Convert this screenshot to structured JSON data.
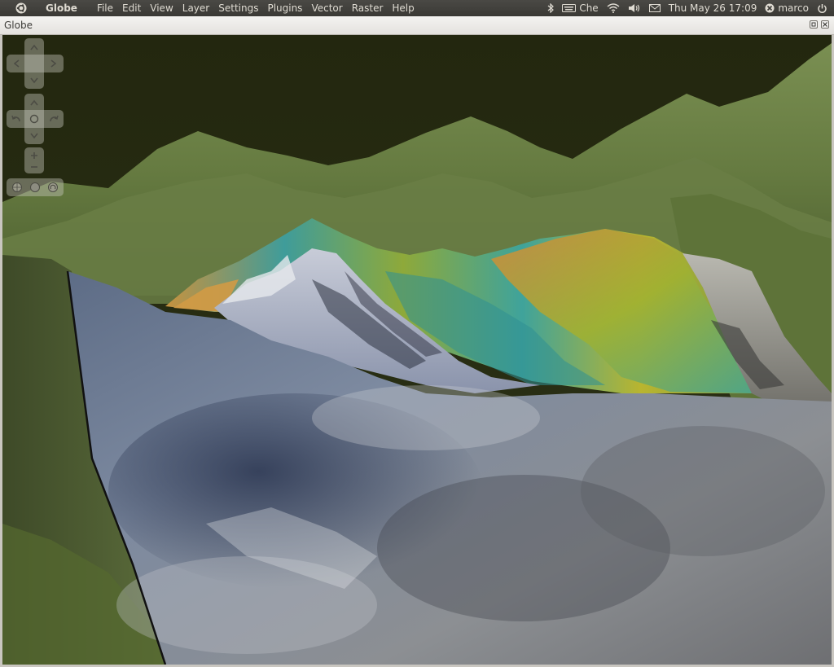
{
  "topbar": {
    "app_name": "Globe",
    "menu": [
      "File",
      "Edit",
      "View",
      "Layer",
      "Settings",
      "Plugins",
      "Vector",
      "Raster",
      "Help"
    ],
    "keyboard_layout": "Che",
    "datetime": "Thu May 26 17:09",
    "user": "marco"
  },
  "window": {
    "title": "Globe"
  },
  "icons": {
    "session": "ubuntu-logo-icon",
    "bluetooth": "bluetooth-icon",
    "keyboard": "keyboard-icon",
    "wifi": "wifi-icon",
    "volume": "volume-icon",
    "mail": "mail-icon",
    "user": "user-x-icon",
    "power": "power-icon"
  },
  "colors": {
    "panel": "#3c3b37",
    "sky": "#262a16",
    "terrain_green": "#6f8447"
  }
}
